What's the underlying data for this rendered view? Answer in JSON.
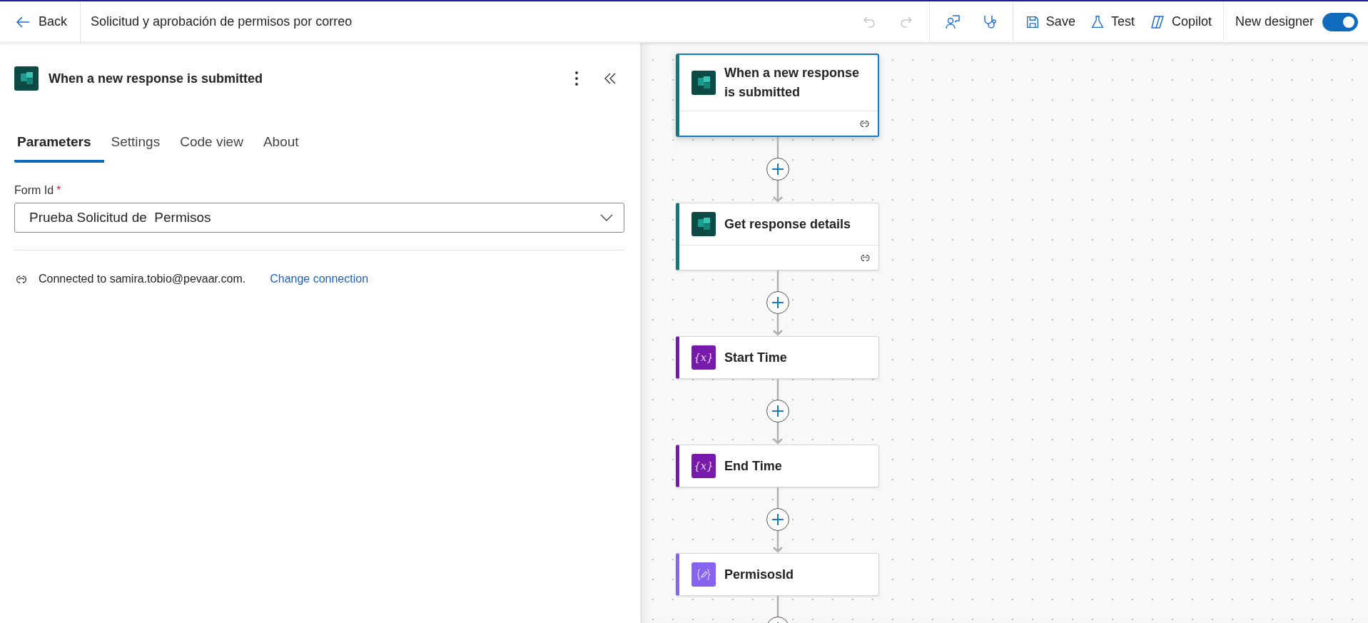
{
  "toolbar": {
    "back": "Back",
    "title": "Solicitud y aprobación de permisos por correo",
    "undo": {
      "disabled": true
    },
    "redo": {
      "disabled": true
    },
    "save": "Save",
    "test": "Test",
    "copilot": "Copilot",
    "new_designer": {
      "label": "New designer",
      "on": true
    }
  },
  "panel": {
    "title": "When a new response is submitted",
    "tabs": [
      {
        "label": "Parameters",
        "selected": true
      },
      {
        "label": "Settings",
        "selected": false
      },
      {
        "label": "Code view",
        "selected": false
      },
      {
        "label": "About",
        "selected": false
      }
    ],
    "field": {
      "label": "Form Id",
      "required_mark": "*",
      "value": "Prueba Solicitud de  Permisos"
    },
    "connection": {
      "text": "Connected to samira.tobio@pevaar.com.",
      "link": "Change connection"
    }
  },
  "flow": [
    {
      "kind": "forms",
      "title": "When a new response is submitted",
      "selected": true,
      "connection": true
    },
    {
      "kind": "forms",
      "title": "Get response details",
      "selected": false,
      "connection": true
    },
    {
      "kind": "variable",
      "icon_text": "{x}",
      "title": "Start Time",
      "selected": false,
      "connection": false
    },
    {
      "kind": "variable",
      "icon_text": "{x}",
      "title": "End Time",
      "selected": false,
      "connection": false
    },
    {
      "kind": "variable-edit",
      "title": "PermisosId",
      "selected": false,
      "connection": false
    }
  ]
}
